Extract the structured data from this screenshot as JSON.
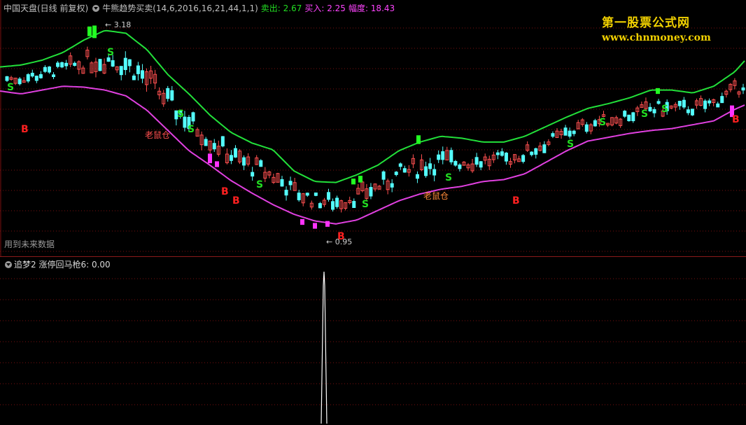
{
  "header": {
    "stock_name": "中国天盘(日线 前复权)",
    "indicator": "牛熊趋势买卖(14,6,2016,16,21,44,1,1)",
    "sell_label": "卖出: 2.67",
    "buy_label": "买入: 2.25",
    "amp_label": "幅度: 18.43"
  },
  "watermark": {
    "line1": "第一股票公式网",
    "line2": "www.chnmoney.com"
  },
  "note": "用到未来数据",
  "annotations": {
    "high": "3.18",
    "low": "0.95",
    "signal_text": "老鼠仓"
  },
  "bottom_header": {
    "name": "追梦2",
    "value_label": "涨停回马枪6: 0.00"
  },
  "colors": {
    "up": "#ff5050",
    "down": "#54ffff",
    "upper_band": "#22e03a",
    "lower_band": "#e040e0",
    "signal_green": "#22ff22",
    "signal_magenta": "#ff33ff",
    "buy_text": "#ff2020",
    "sell_text": "#22dd22",
    "grid": "#7a1010"
  },
  "chart_data": {
    "type": "line",
    "title": "",
    "series": [
      {
        "name": "upper_band",
        "x": [
          0,
          30,
          60,
          90,
          120,
          150,
          180,
          210,
          240,
          270,
          300,
          330,
          360,
          390,
          420,
          450,
          480,
          510,
          540,
          570,
          600,
          630,
          660,
          690,
          720,
          750,
          780,
          810,
          840,
          870,
          900,
          930,
          960,
          990,
          1020,
          1050,
          1066
        ],
        "values": [
          2.7,
          2.72,
          2.77,
          2.85,
          2.98,
          3.08,
          3.05,
          2.88,
          2.62,
          2.42,
          2.2,
          2.02,
          1.91,
          1.84,
          1.62,
          1.51,
          1.5,
          1.58,
          1.68,
          1.83,
          1.92,
          1.98,
          1.96,
          1.92,
          1.92,
          1.98,
          2.08,
          2.18,
          2.27,
          2.32,
          2.38,
          2.46,
          2.46,
          2.43,
          2.5,
          2.65,
          2.78
        ]
      },
      {
        "name": "lower_band",
        "x": [
          0,
          30,
          60,
          90,
          120,
          150,
          180,
          210,
          240,
          270,
          300,
          330,
          360,
          390,
          420,
          450,
          480,
          510,
          540,
          570,
          600,
          630,
          660,
          690,
          720,
          750,
          780,
          810,
          840,
          870,
          900,
          930,
          960,
          990,
          1020,
          1050,
          1066
        ],
        "values": [
          2.45,
          2.42,
          2.46,
          2.5,
          2.49,
          2.46,
          2.4,
          2.25,
          2.04,
          1.83,
          1.68,
          1.52,
          1.39,
          1.27,
          1.17,
          1.1,
          1.07,
          1.11,
          1.21,
          1.31,
          1.38,
          1.43,
          1.46,
          1.51,
          1.53,
          1.59,
          1.71,
          1.83,
          1.93,
          1.97,
          2.01,
          2.04,
          2.06,
          2.1,
          2.14,
          2.26,
          2.31
        ]
      }
    ],
    "price_range": [
      0.85,
      3.25
    ],
    "kline_x_range": [
      10,
      1062
    ],
    "kline_count": 175,
    "kline_seed": 7,
    "bottom_spike": {
      "x": 463,
      "value": 1.0,
      "ylim": [
        0,
        1
      ]
    }
  }
}
